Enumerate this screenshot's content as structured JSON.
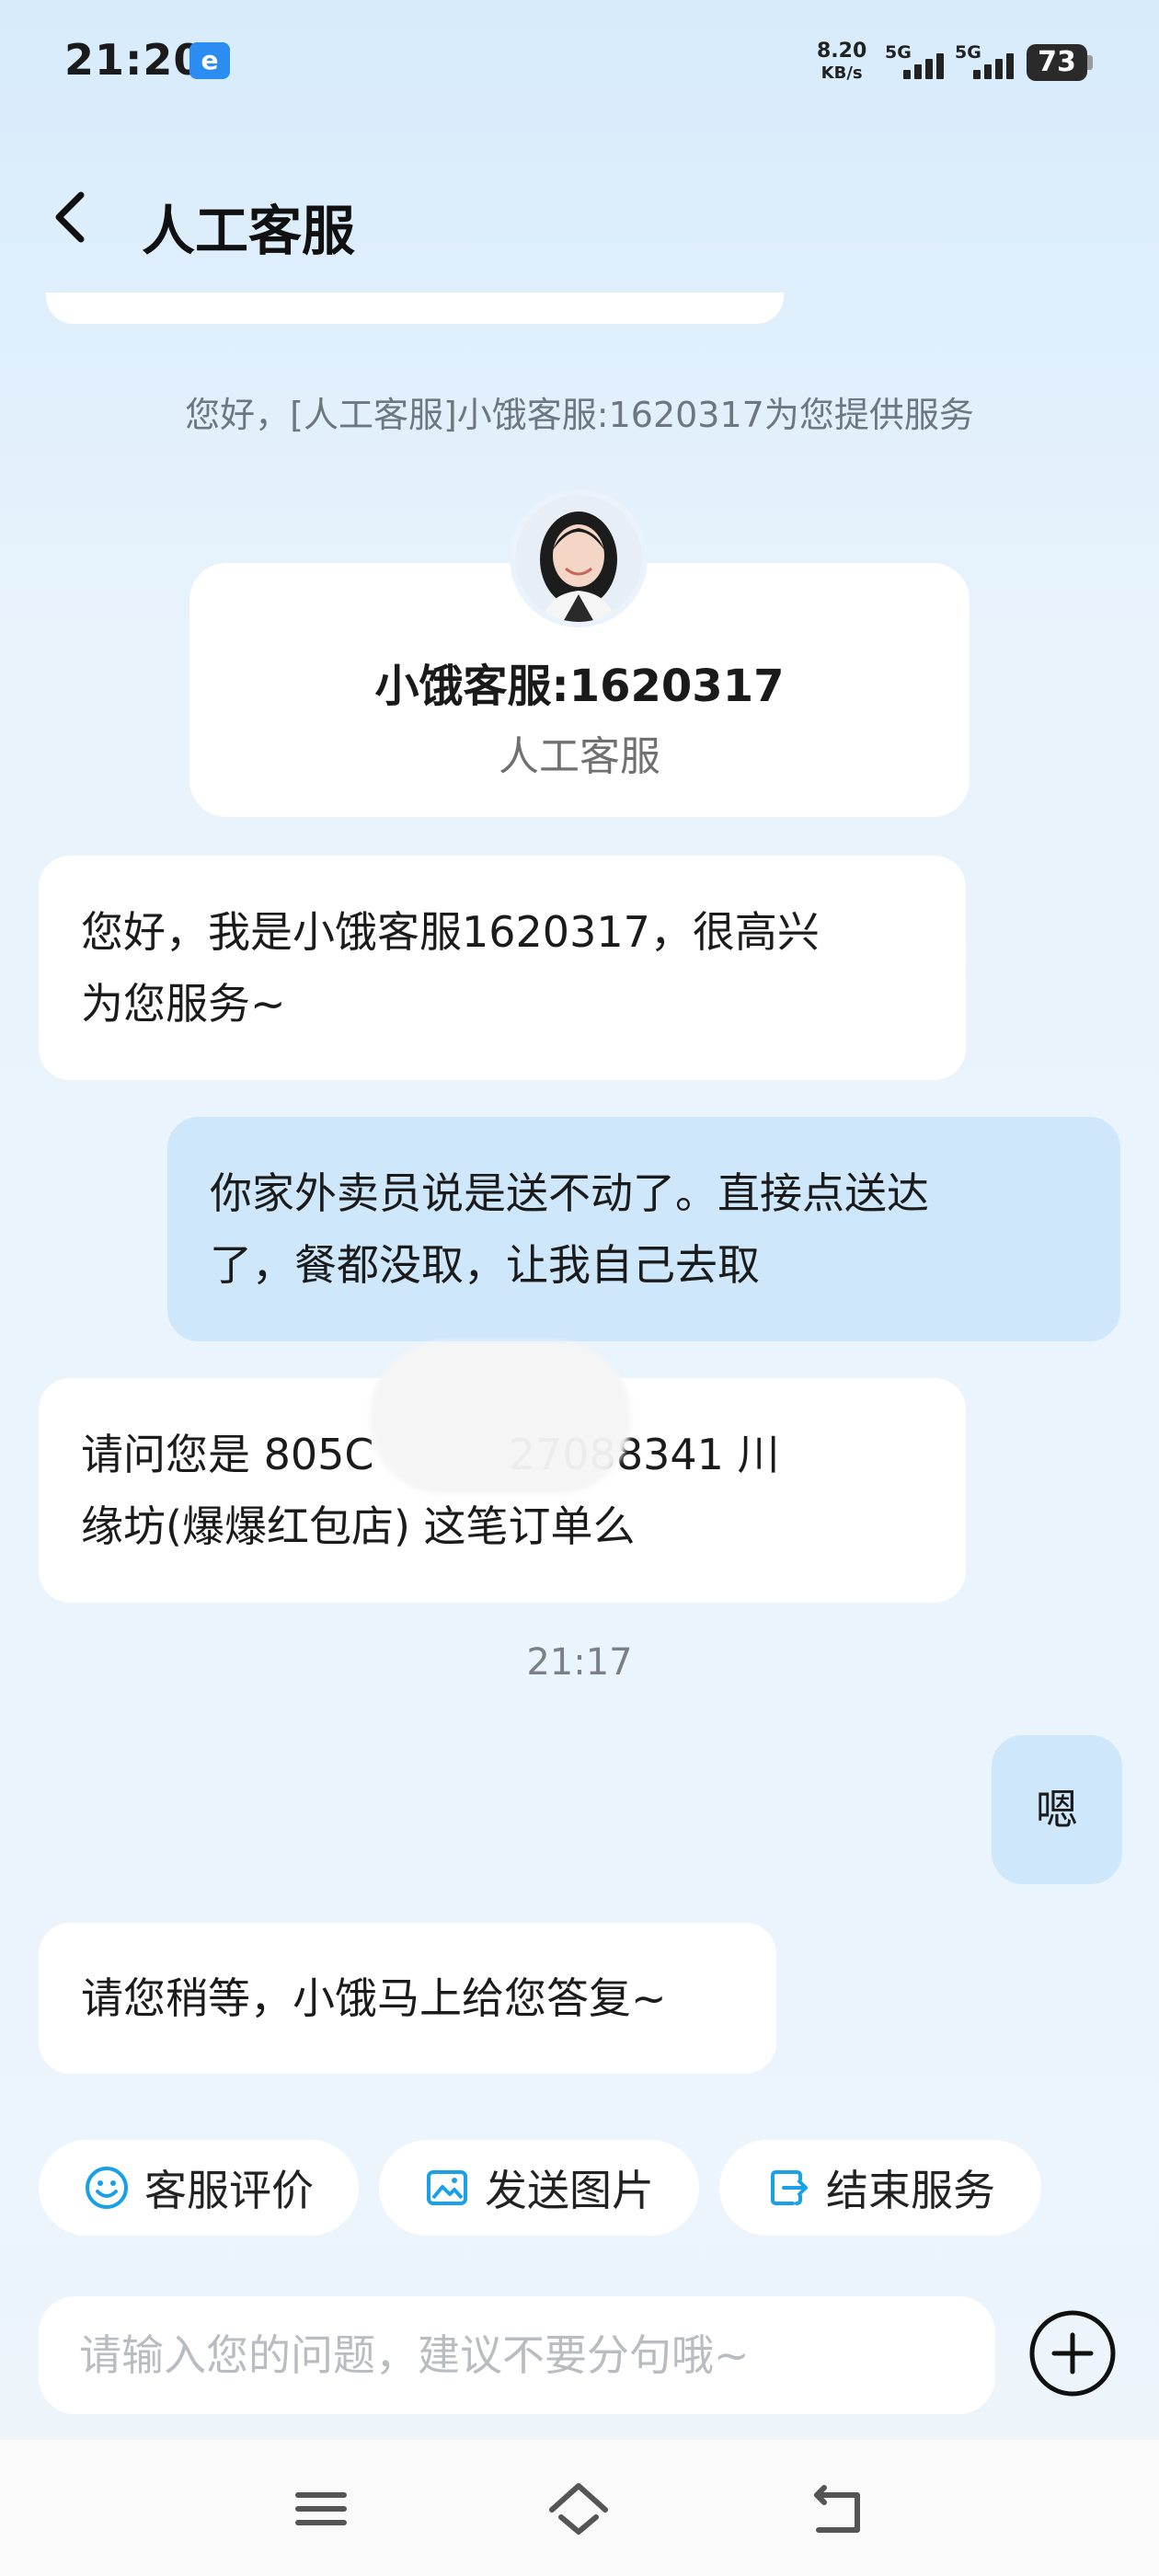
{
  "status_bar": {
    "time": "21:20",
    "app_icon_label": "e",
    "net_speed_value": "8.20",
    "net_speed_unit": "KB/s",
    "sim1": "5G",
    "sim2": "5G",
    "battery": "73"
  },
  "header": {
    "title": "人工客服",
    "back_icon": "chevron-left-icon"
  },
  "system_notice": "您好，[人工客服]小饿客服:1620317为您提供服务",
  "agent_card": {
    "name": "小饿客服:1620317",
    "role": "人工客服"
  },
  "messages": [
    {
      "from": "agent",
      "lines": [
        "您好，我是小饿客服1620317，很高兴",
        "为您服务~"
      ]
    },
    {
      "from": "user",
      "lines": [
        "你家外卖员说是送不动了。直接点送达",
        "了，餐都没取，让我自己去取"
      ]
    },
    {
      "from": "agent",
      "lines": [
        "请问您是 805C          27088341 川",
        "缘坊(爆爆红包店) 这笔订单么"
      ]
    },
    {
      "from": "user",
      "lines": [
        "嗯"
      ]
    },
    {
      "from": "agent",
      "lines": [
        "请您稍等，小饿马上给您答复~"
      ]
    }
  ],
  "timestamp": "21:17",
  "actions": [
    {
      "label": "客服评价",
      "icon": "smiley-icon"
    },
    {
      "label": "发送图片",
      "icon": "image-icon"
    },
    {
      "label": "结束服务",
      "icon": "exit-icon"
    }
  ],
  "input": {
    "placeholder": "请输入您的问题，建议不要分句哦~",
    "value": ""
  },
  "colors": {
    "accent": "#1aa0e8",
    "user_bubble": "#cfe7fb",
    "agent_bubble": "#ffffff"
  },
  "nav_bar": [
    "menu-icon",
    "home-icon",
    "back-icon"
  ]
}
